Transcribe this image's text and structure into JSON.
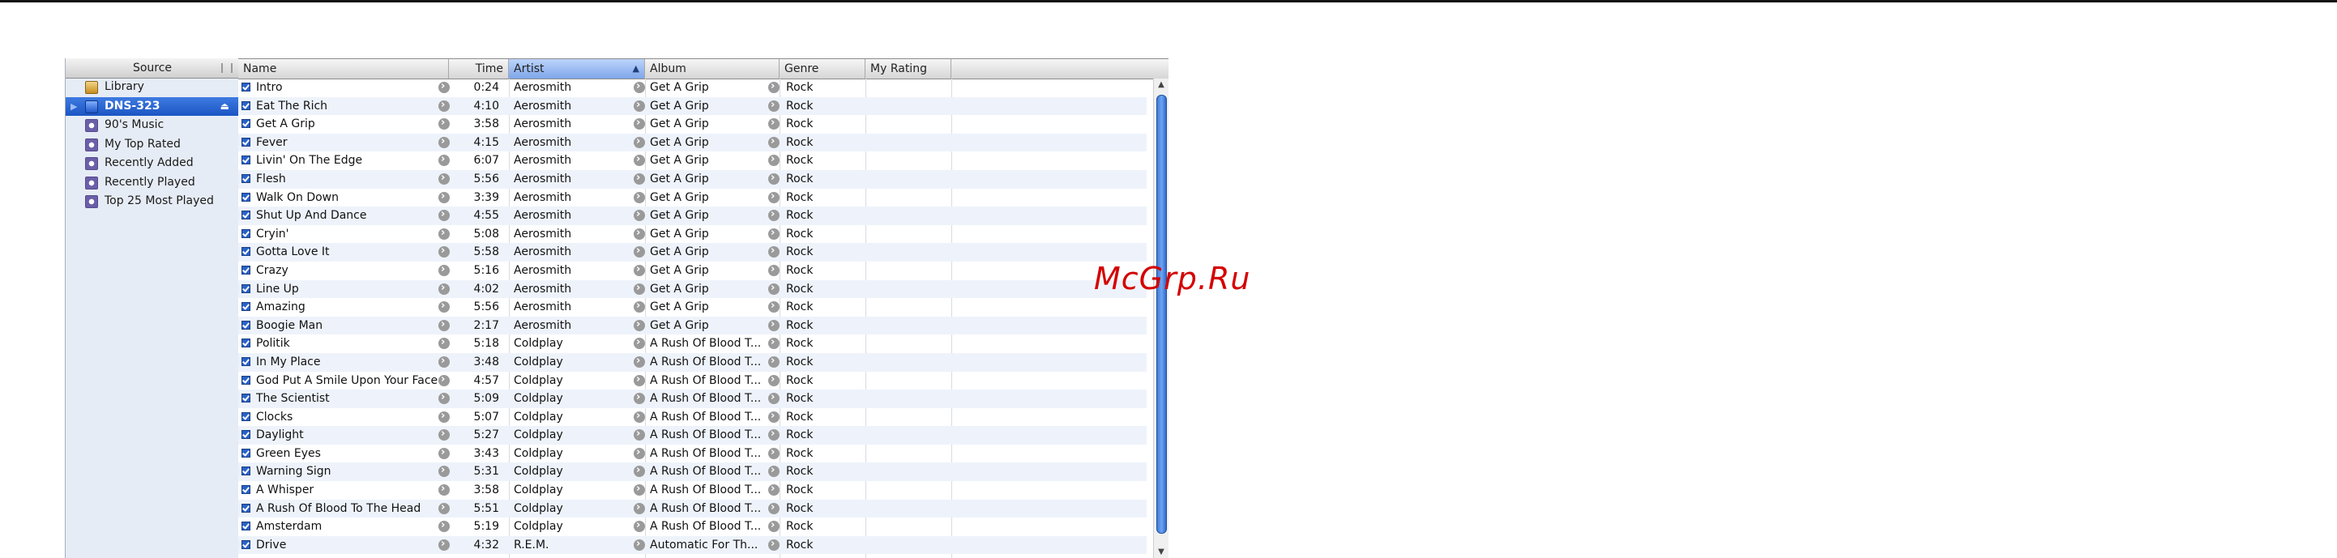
{
  "watermark": "McGrp.Ru",
  "source": {
    "header": "Source",
    "items": [
      {
        "label": "Library",
        "icon": "library-icon"
      },
      {
        "label": "DNS-323",
        "icon": "device-icon",
        "selected": true
      },
      {
        "label": "90's Music",
        "icon": "smart-playlist-icon"
      },
      {
        "label": "My Top Rated",
        "icon": "smart-playlist-icon"
      },
      {
        "label": "Recently Added",
        "icon": "smart-playlist-icon"
      },
      {
        "label": "Recently Played",
        "icon": "smart-playlist-icon"
      },
      {
        "label": "Top 25 Most Played",
        "icon": "smart-playlist-icon"
      }
    ]
  },
  "columns": {
    "name": "Name",
    "time": "Time",
    "artist": "Artist",
    "album": "Album",
    "genre": "Genre",
    "rating": "My Rating",
    "sorted_by": "Artist"
  },
  "tracks": [
    {
      "name": "Intro",
      "time": "0:24",
      "artist": "Aerosmith",
      "album": "Get A Grip",
      "genre": "Rock"
    },
    {
      "name": "Eat The Rich",
      "time": "4:10",
      "artist": "Aerosmith",
      "album": "Get A Grip",
      "genre": "Rock"
    },
    {
      "name": "Get A Grip",
      "time": "3:58",
      "artist": "Aerosmith",
      "album": "Get A Grip",
      "genre": "Rock"
    },
    {
      "name": "Fever",
      "time": "4:15",
      "artist": "Aerosmith",
      "album": "Get A Grip",
      "genre": "Rock"
    },
    {
      "name": "Livin' On The Edge",
      "time": "6:07",
      "artist": "Aerosmith",
      "album": "Get A Grip",
      "genre": "Rock"
    },
    {
      "name": "Flesh",
      "time": "5:56",
      "artist": "Aerosmith",
      "album": "Get A Grip",
      "genre": "Rock"
    },
    {
      "name": "Walk On Down",
      "time": "3:39",
      "artist": "Aerosmith",
      "album": "Get A Grip",
      "genre": "Rock"
    },
    {
      "name": "Shut Up And Dance",
      "time": "4:55",
      "artist": "Aerosmith",
      "album": "Get A Grip",
      "genre": "Rock"
    },
    {
      "name": "Cryin'",
      "time": "5:08",
      "artist": "Aerosmith",
      "album": "Get A Grip",
      "genre": "Rock"
    },
    {
      "name": "Gotta Love It",
      "time": "5:58",
      "artist": "Aerosmith",
      "album": "Get A Grip",
      "genre": "Rock"
    },
    {
      "name": "Crazy",
      "time": "5:16",
      "artist": "Aerosmith",
      "album": "Get A Grip",
      "genre": "Rock"
    },
    {
      "name": "Line Up",
      "time": "4:02",
      "artist": "Aerosmith",
      "album": "Get A Grip",
      "genre": "Rock"
    },
    {
      "name": "Amazing",
      "time": "5:56",
      "artist": "Aerosmith",
      "album": "Get A Grip",
      "genre": "Rock"
    },
    {
      "name": "Boogie Man",
      "time": "2:17",
      "artist": "Aerosmith",
      "album": "Get A Grip",
      "genre": "Rock"
    },
    {
      "name": "Politik",
      "time": "5:18",
      "artist": "Coldplay",
      "album": "A Rush Of Blood T...",
      "genre": "Rock"
    },
    {
      "name": "In My Place",
      "time": "3:48",
      "artist": "Coldplay",
      "album": "A Rush Of Blood T...",
      "genre": "Rock"
    },
    {
      "name": "God Put A Smile Upon Your Face",
      "time": "4:57",
      "artist": "Coldplay",
      "album": "A Rush Of Blood T...",
      "genre": "Rock"
    },
    {
      "name": "The Scientist",
      "time": "5:09",
      "artist": "Coldplay",
      "album": "A Rush Of Blood T...",
      "genre": "Rock"
    },
    {
      "name": "Clocks",
      "time": "5:07",
      "artist": "Coldplay",
      "album": "A Rush Of Blood T...",
      "genre": "Rock"
    },
    {
      "name": "Daylight",
      "time": "5:27",
      "artist": "Coldplay",
      "album": "A Rush Of Blood T...",
      "genre": "Rock"
    },
    {
      "name": "Green Eyes",
      "time": "3:43",
      "artist": "Coldplay",
      "album": "A Rush Of Blood T...",
      "genre": "Rock"
    },
    {
      "name": "Warning Sign",
      "time": "5:31",
      "artist": "Coldplay",
      "album": "A Rush Of Blood T...",
      "genre": "Rock"
    },
    {
      "name": "A Whisper",
      "time": "3:58",
      "artist": "Coldplay",
      "album": "A Rush Of Blood T...",
      "genre": "Rock"
    },
    {
      "name": "A Rush Of Blood To The Head",
      "time": "5:51",
      "artist": "Coldplay",
      "album": "A Rush Of Blood T...",
      "genre": "Rock"
    },
    {
      "name": "Amsterdam",
      "time": "5:19",
      "artist": "Coldplay",
      "album": "A Rush Of Blood T...",
      "genre": "Rock"
    },
    {
      "name": "Drive",
      "time": "4:32",
      "artist": "R.E.M.",
      "album": "Automatic For Th...",
      "genre": "Rock"
    }
  ]
}
